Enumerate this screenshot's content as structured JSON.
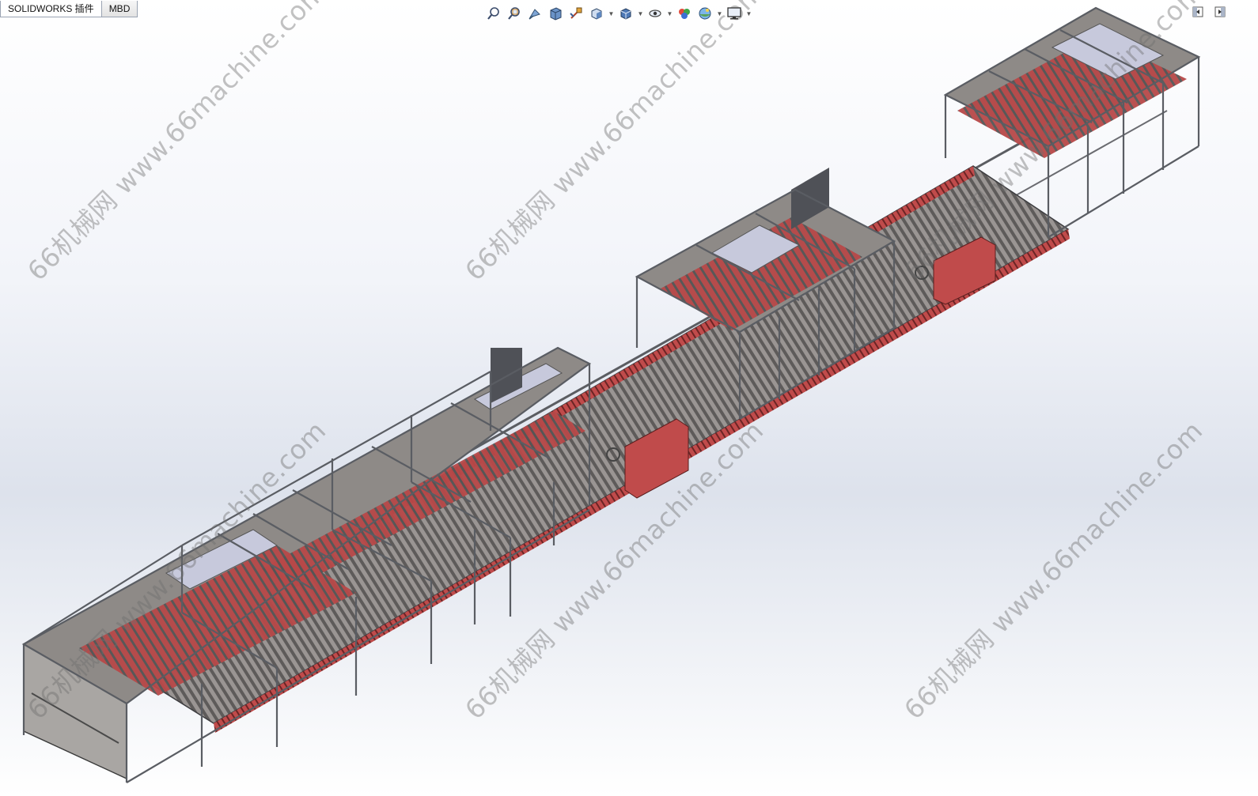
{
  "tabs": [
    {
      "label": "SOLIDWORKS 插件"
    },
    {
      "label": "MBD"
    }
  ],
  "heads_up_toolbar": {
    "icons": [
      "zoom-to-fit-icon",
      "zoom-to-area-icon",
      "previous-view-icon",
      "section-view-icon",
      "dynamic-annotation-views-icon",
      "view-orientation-icon",
      "display-style-icon",
      "hide-show-items-icon",
      "edit-appearance-icon",
      "apply-scene-icon",
      "view-settings-icon"
    ]
  },
  "window_controls": [
    "tile-left-icon",
    "tile-right-icon"
  ],
  "watermark": {
    "text": "66机械网 www.66machine.com"
  },
  "colors": {
    "frame": "#666a70",
    "conveyor_red": "#b04545",
    "housing_grey": "#8e8a87",
    "panel_dark": "#4f5157"
  }
}
